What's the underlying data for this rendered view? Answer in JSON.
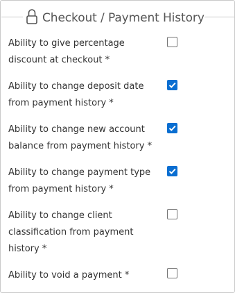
{
  "legend": {
    "icon": "lock-icon",
    "title": "Checkout / Payment History"
  },
  "permissions": [
    {
      "label": "Ability to give percentage discount at checkout *",
      "checked": false
    },
    {
      "label": "Ability to change deposit date from payment history *",
      "checked": true
    },
    {
      "label": "Ability to change new account balance from payment history *",
      "checked": true
    },
    {
      "label": "Ability to change payment type from payment history *",
      "checked": true
    },
    {
      "label": "Ability to change client classification from payment history *",
      "checked": false
    },
    {
      "label": "Ability to void a payment *",
      "checked": false
    }
  ],
  "colors": {
    "checkbox_checked": "#0a6ed1",
    "text": "#333333",
    "border": "#c9c9c9"
  }
}
